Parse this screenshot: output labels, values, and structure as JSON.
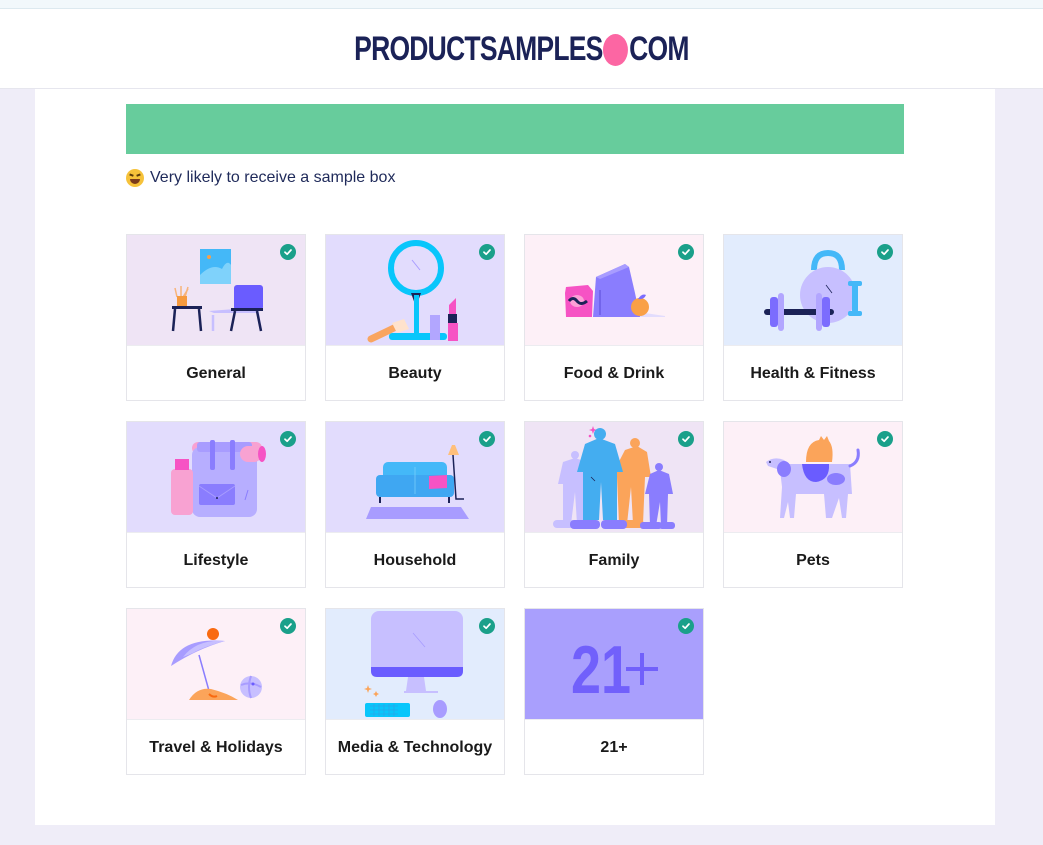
{
  "header": {
    "logo_left": "PRODUCTSAMPLES",
    "logo_right": "COM",
    "logo_dot_color": "#fc66a3",
    "logo_text_color": "#1b2257"
  },
  "progress": {
    "fill_fraction": 1.0,
    "color": "#67cc9c"
  },
  "likelihood": {
    "emoji": "laughing-face",
    "text": "Very likely to receive a sample box"
  },
  "categories": [
    {
      "label": "General",
      "selected": true,
      "icon": "living-room-illustration",
      "bg": "#efe4f5"
    },
    {
      "label": "Beauty",
      "selected": true,
      "icon": "mirror-makeup-illustration",
      "bg": "#e2dcfd"
    },
    {
      "label": "Food & Drink",
      "selected": true,
      "icon": "groceries-illustration",
      "bg": "#fdf0f7"
    },
    {
      "label": "Health & Fitness",
      "selected": true,
      "icon": "weights-illustration",
      "bg": "#e2ecfd"
    },
    {
      "label": "Lifestyle",
      "selected": true,
      "icon": "backpack-illustration",
      "bg": "#e2dcfd"
    },
    {
      "label": "Household",
      "selected": true,
      "icon": "sofa-illustration",
      "bg": "#e2dcfd"
    },
    {
      "label": "Family",
      "selected": true,
      "icon": "family-illustration",
      "bg": "#efe4f5"
    },
    {
      "label": "Pets",
      "selected": true,
      "icon": "dog-cat-illustration",
      "bg": "#fdf0f7"
    },
    {
      "label": "Travel & Holidays",
      "selected": true,
      "icon": "beach-umbrella-illustration",
      "bg": "#fdf0f7"
    },
    {
      "label": "Media & Technology",
      "selected": true,
      "icon": "computer-illustration",
      "bg": "#e2ecfd"
    },
    {
      "label": "21+",
      "selected": true,
      "icon": "age-21-plus-illustration",
      "bg": "#a99ffd",
      "image_text": "21+"
    }
  ],
  "colors": {
    "check": "#1aa08a"
  }
}
